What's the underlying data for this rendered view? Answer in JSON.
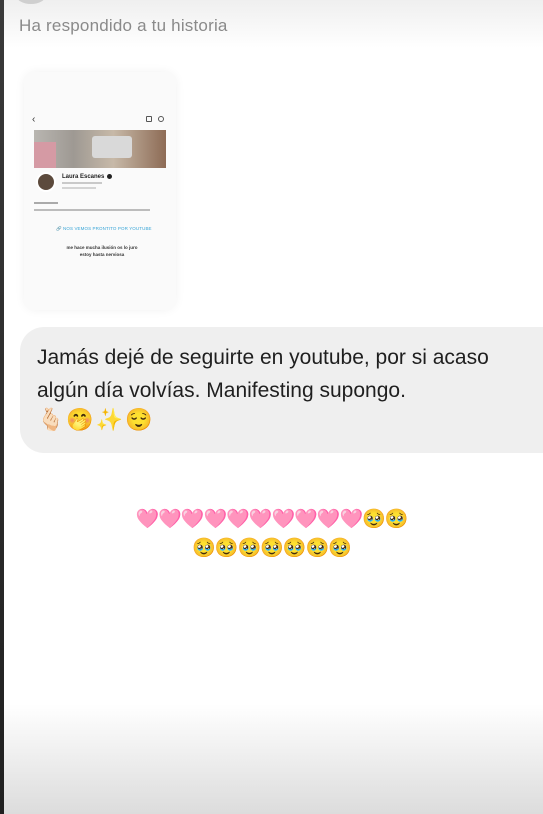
{
  "header": {
    "reply_label": "Ha respondido a tu historia"
  },
  "story_preview": {
    "profile_name": "Laura Escanes",
    "link_text": "🔗 NOS VEMOS PRONTITO POR YOUTUBE",
    "caption": "me hace mucha ilusión os lo juro estoy hasta nerviosa"
  },
  "message": {
    "text": "Jamás dejé de seguirte en youtube, por si acaso algún día volvías. Manifesting supongo.",
    "emojis": "🫰🏻🤭✨😌"
  },
  "reaction": {
    "hearts_line": "🩷🩷🩷🩷🩷🩷🩷🩷🩷🩷🥹🥹",
    "faces_line": "🥹🥹🥹🥹🥹🥹🥹"
  },
  "colors": {
    "bubble": "#efefef",
    "header_text": "#8a8a8a",
    "link": "#3aa6d8"
  }
}
